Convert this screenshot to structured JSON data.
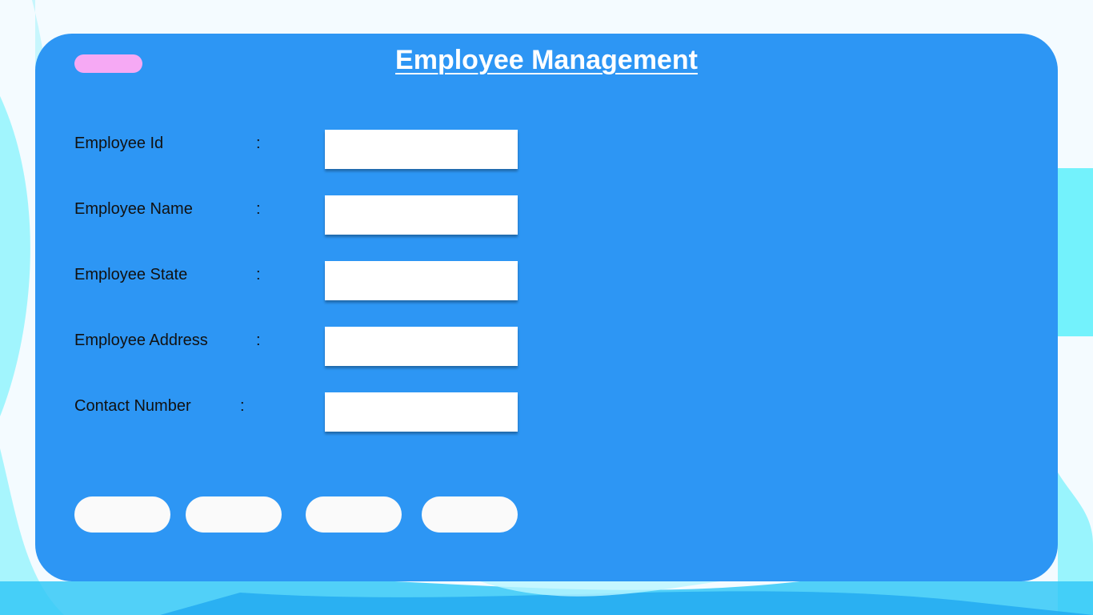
{
  "page": {
    "title": "Employee Management"
  },
  "colors": {
    "card": "#2d96f4",
    "accent_pill": "#f6a9f4",
    "input_bg": "#ffffff",
    "button_bg": "#fafafa",
    "background": "#f4fbff",
    "background_accent": "#5cf0fb"
  },
  "form": {
    "colon": ":",
    "fields": [
      {
        "label": "Employee Id",
        "value": "",
        "placeholder": ""
      },
      {
        "label": "Employee Name",
        "value": "",
        "placeholder": ""
      },
      {
        "label": "Employee State",
        "value": "",
        "placeholder": ""
      },
      {
        "label": "Employee Address",
        "value": "",
        "placeholder": ""
      },
      {
        "label": "Contact Number",
        "value": "",
        "placeholder": ""
      }
    ]
  },
  "buttons": [
    {
      "label": ""
    },
    {
      "label": ""
    },
    {
      "label": ""
    },
    {
      "label": ""
    }
  ]
}
